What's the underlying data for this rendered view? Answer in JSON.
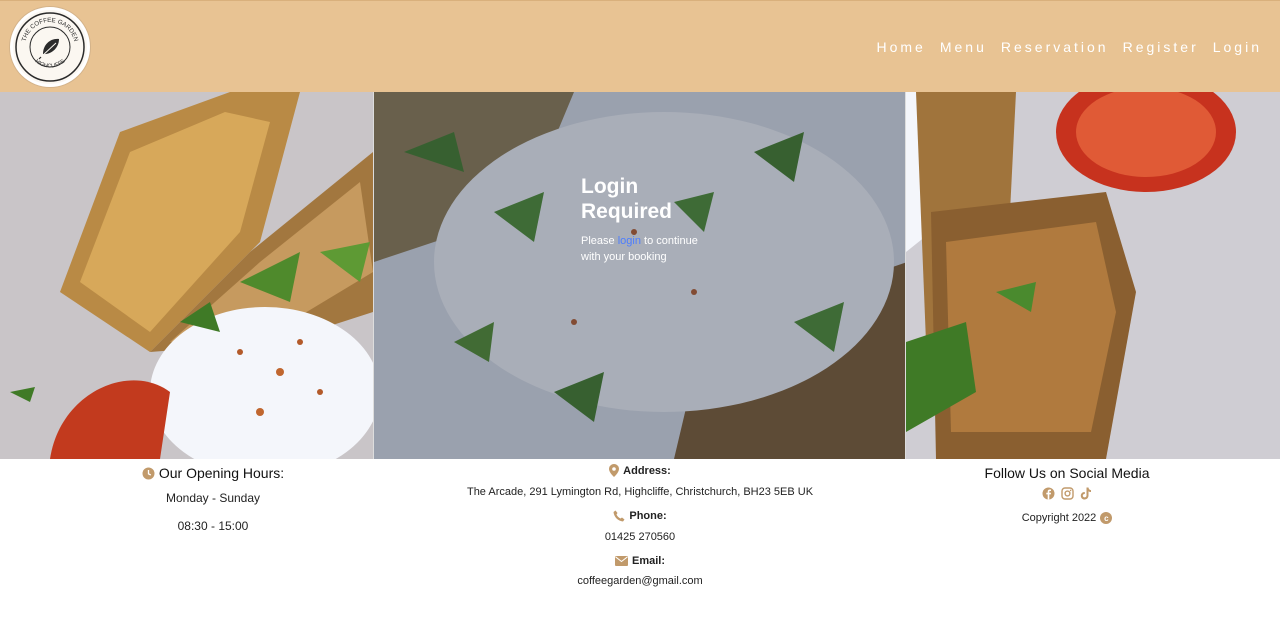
{
  "colors": {
    "header_bg": "#e8c393",
    "accent_icon": "#c19a6b",
    "link": "#4c7dff"
  },
  "logo": {
    "top_text": "THE COFFEE GARDEN",
    "bottom_text": "HIGHCLIFFE",
    "icon": "leaf-icon"
  },
  "nav": {
    "items": [
      "Home",
      "Menu",
      "Reservation",
      "Register",
      "Login"
    ]
  },
  "login": {
    "title": "Login Required",
    "text_before": "Please ",
    "link_label": "login",
    "text_after": " to continue with your booking"
  },
  "footer": {
    "hours": {
      "icon": "clock-icon",
      "title": "Our Opening Hours:",
      "days": "Monday - Sunday",
      "time": "08:30 - 15:00"
    },
    "contact": {
      "address_icon": "map-marker-icon",
      "address_label": "Address:",
      "address": "The Arcade, 291 Lymington Rd, Highcliffe, Christchurch, BH23 5EB UK",
      "phone_icon": "phone-icon",
      "phone_label": "Phone:",
      "phone": "01425 270560",
      "email_icon": "envelope-icon",
      "email_label": "Email:",
      "email": "coffeegarden@gmail.com"
    },
    "social": {
      "title": "Follow Us on Social Media",
      "icons": [
        "facebook-icon",
        "instagram-icon",
        "tiktok-icon"
      ],
      "copyright": "Copyright 2022"
    }
  }
}
